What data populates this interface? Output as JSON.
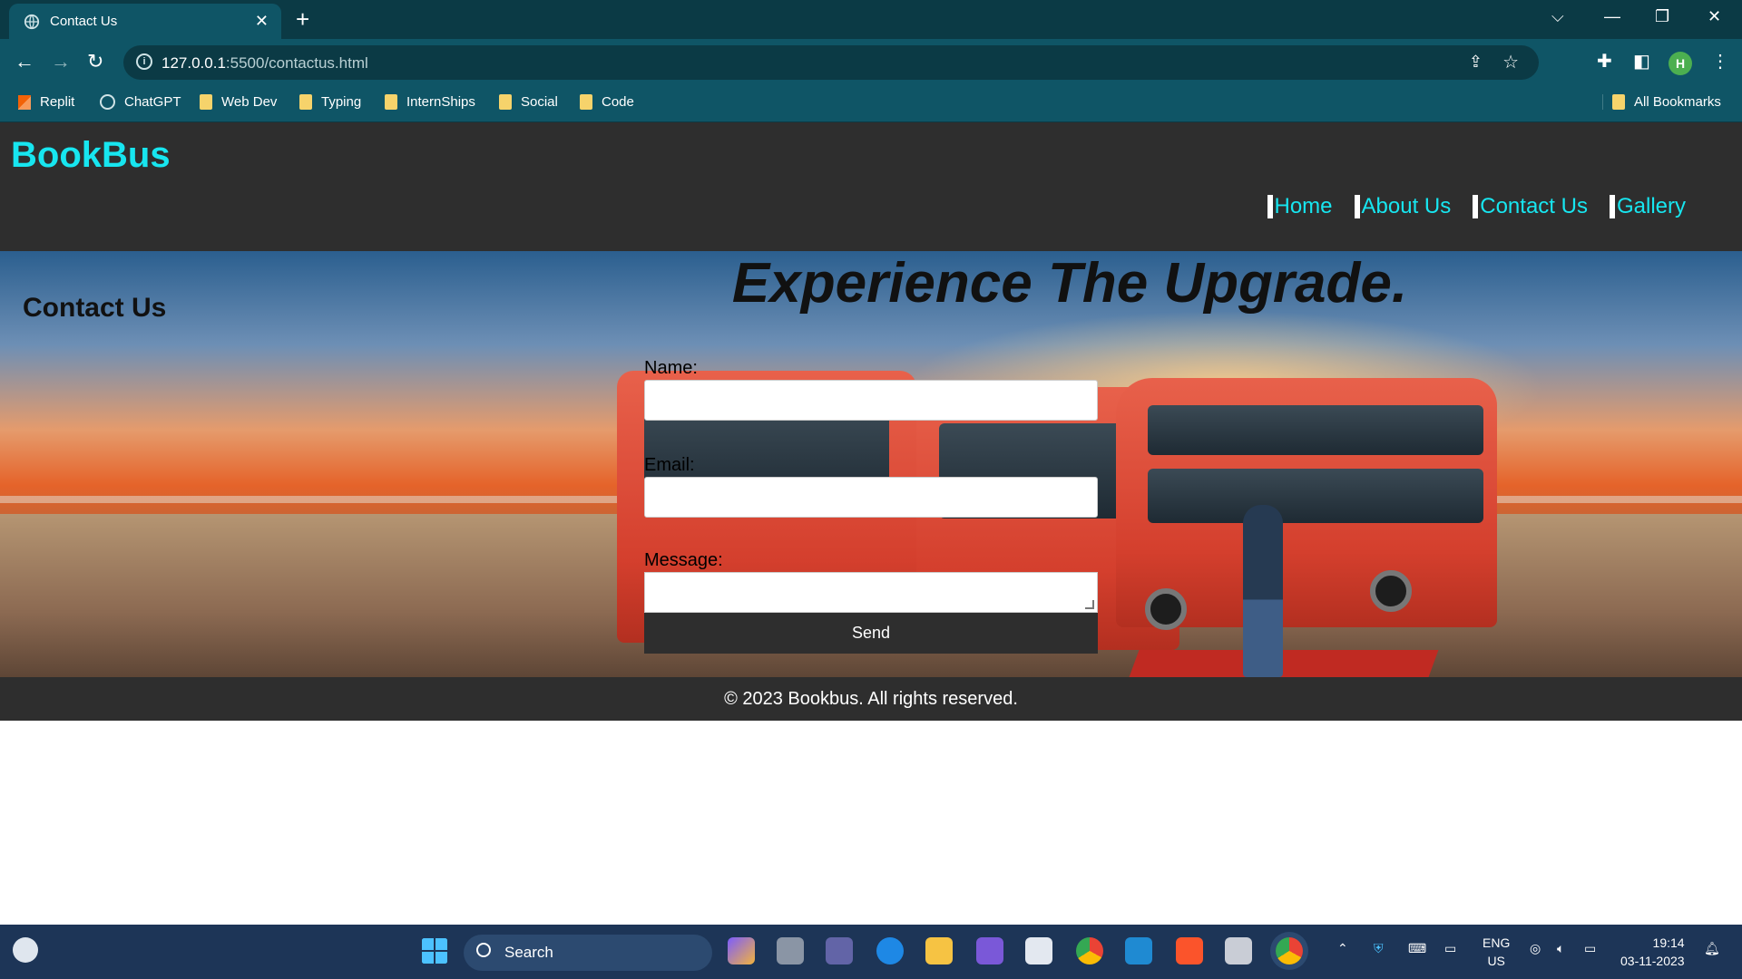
{
  "browser": {
    "tab_title": "Contact Us",
    "url_host": "127.0.0.1",
    "url_rest": ":5500/contactus.html",
    "bookmarks": [
      "Replit",
      "ChatGPT",
      "Web Dev",
      "Typing",
      "InternShips",
      "Social",
      "Code"
    ],
    "all_bookmarks": "All Bookmarks",
    "profile_initial": "H"
  },
  "site": {
    "logo": "BookBus",
    "nav": [
      "Home",
      "About Us",
      "Contact Us",
      "Gallery"
    ]
  },
  "hero": {
    "headline": "Experience The Upgrade.",
    "section_title": "Contact Us"
  },
  "form": {
    "name_label": "Name:",
    "email_label": "Email:",
    "message_label": "Message:",
    "send_label": "Send"
  },
  "footer": {
    "text": "© 2023 Bookbus. All rights reserved."
  },
  "taskbar": {
    "search_label": "Search",
    "lang_line1": "ENG",
    "lang_line2": "US",
    "time": "19:14",
    "date": "03-11-2023"
  },
  "colors": {
    "accent": "#17e6f0",
    "header_bg": "#2e2e2e",
    "browser_bg": "#0f5566"
  }
}
